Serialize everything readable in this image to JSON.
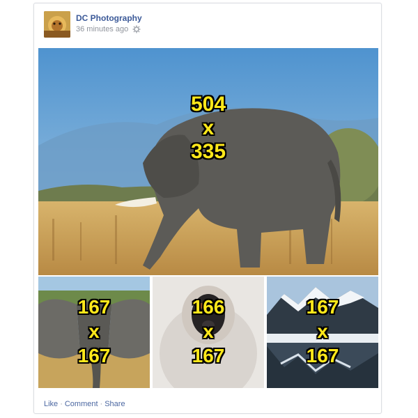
{
  "post": {
    "author": "DC Photography",
    "timestamp": "36 minutes ago",
    "privacy_icon": "gear-icon"
  },
  "photos": {
    "main": {
      "w": "504",
      "x": "x",
      "h": "335"
    },
    "thumb1": {
      "w": "167",
      "x": "x",
      "h": "167"
    },
    "thumb2": {
      "w": "166",
      "x": "x",
      "h": "167"
    },
    "thumb3": {
      "w": "167",
      "x": "x",
      "h": "167"
    }
  },
  "actions": {
    "like": "Like",
    "comment": "Comment",
    "share": "Share",
    "separator": "·"
  },
  "colors": {
    "link": "#3b5998",
    "overlay_text": "#ffe81a",
    "meta_text": "#90949c"
  }
}
